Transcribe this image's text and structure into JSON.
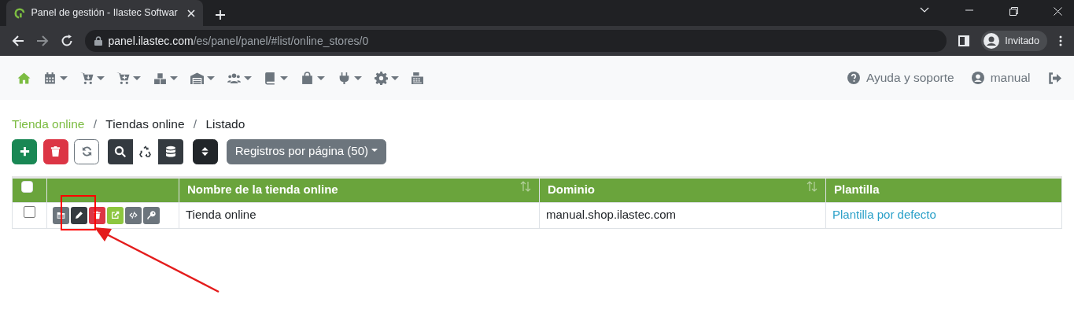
{
  "browser": {
    "tab_title": "Panel de gestión - Ilastec Softwar",
    "url_host": "panel.ilastec.com",
    "url_path": "/es/panel/panel/#list/online_stores/0",
    "profile": "Invitado"
  },
  "nav_menus": [
    {
      "kind": "home",
      "selected": true,
      "caret": false
    },
    {
      "kind": "calendar",
      "selected": false,
      "caret": true
    },
    {
      "kind": "cart-down",
      "selected": false,
      "caret": true
    },
    {
      "kind": "cart-plus",
      "selected": false,
      "caret": true
    },
    {
      "kind": "boxes",
      "selected": false,
      "caret": true
    },
    {
      "kind": "warehouse",
      "selected": false,
      "caret": true
    },
    {
      "kind": "users",
      "selected": false,
      "caret": true
    },
    {
      "kind": "book",
      "selected": false,
      "caret": true
    },
    {
      "kind": "bag",
      "selected": false,
      "caret": true
    },
    {
      "kind": "plug",
      "selected": false,
      "caret": true
    },
    {
      "kind": "gear",
      "selected": false,
      "caret": true
    },
    {
      "kind": "register",
      "selected": false,
      "caret": false
    }
  ],
  "nav_right": {
    "help": "Ayuda y soporte",
    "user": "manual"
  },
  "breadcrumb": [
    {
      "label": "Tienda online",
      "link": true
    },
    {
      "separator": "/",
      "label": "Tiendas online",
      "link": false
    },
    {
      "separator": "/",
      "label": "Listado",
      "link": false
    }
  ],
  "toolbar": [
    {
      "kind": "add"
    },
    {
      "kind": "delete"
    },
    {
      "kind": "refresh"
    },
    {
      "kind": "group",
      "buttons": [
        {
          "kind": "search",
          "selected": false
        },
        {
          "kind": "recycle",
          "selected": true
        },
        {
          "kind": "database",
          "selected": false
        }
      ]
    },
    {
      "kind": "sort"
    }
  ],
  "page_size": {
    "label": "Registros por página (50)"
  },
  "table": {
    "select_all": {
      "checked": false
    },
    "columns": [
      {
        "label": "Nombre de la tienda online",
        "sortable": true
      },
      {
        "label": "Dominio",
        "sortable": true
      },
      {
        "label": "Plantilla",
        "sortable": false
      }
    ],
    "rows": [
      {
        "checked": false,
        "actions": [
          {
            "kind": "folder"
          },
          {
            "kind": "edit"
          },
          {
            "kind": "delete"
          },
          {
            "kind": "external"
          },
          {
            "kind": "code"
          },
          {
            "kind": "key"
          }
        ],
        "cells": [
          {
            "text": "Tienda online",
            "link": false
          },
          {
            "text": "manual.shop.ilastec.com",
            "link": false
          },
          {
            "text": "Plantilla por defecto",
            "link": true
          }
        ]
      }
    ]
  }
}
